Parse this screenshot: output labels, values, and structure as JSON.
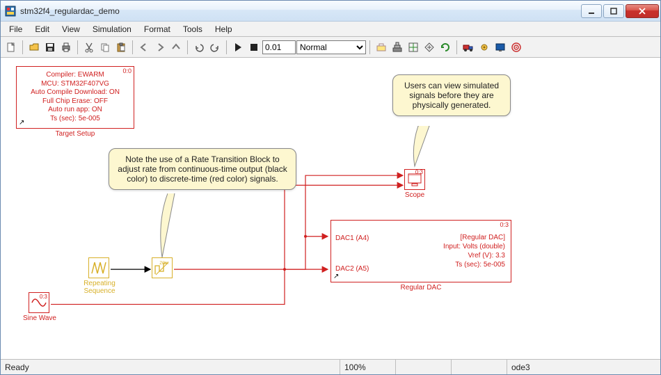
{
  "window": {
    "title": "stm32f4_regulardac_demo"
  },
  "menu": {
    "items": [
      "File",
      "Edit",
      "View",
      "Simulation",
      "Format",
      "Tools",
      "Help"
    ]
  },
  "toolbar": {
    "step_value": "0.01",
    "mode_options": [
      "Normal"
    ],
    "mode_selected": "Normal"
  },
  "target_setup": {
    "corner": "0:0",
    "lines": [
      "Compiler: EWARM",
      "MCU: STM32F407VG",
      "Auto Compile Download: ON",
      "Full Chip Erase: OFF",
      "Auto run app: ON",
      "Ts (sec): 5e-005"
    ],
    "label": "Target Setup"
  },
  "callout_rate": {
    "text": "Note the use of a Rate Transition Block to adjust rate from continuous-time output (black color) to discrete-time (red color) signals."
  },
  "callout_scope": {
    "text": "Users can view simulated signals before they are physically generated."
  },
  "repeating_sequence": {
    "label": "Repeating\nSequence"
  },
  "sine_wave": {
    "label": "Sine Wave"
  },
  "rate_transition": {
    "label": "ZOH"
  },
  "scope": {
    "label": "Scope",
    "corner": "0:3"
  },
  "dac": {
    "corner": "0:3",
    "port1": "DAC1 (A4)",
    "port2": "DAC2 (A5)",
    "info": [
      "[Regular DAC]",
      "Input: Volts (double)",
      "Vref (V): 3.3",
      "Ts (sec): 5e-005"
    ],
    "label": "Regular DAC"
  },
  "status": {
    "ready": "Ready",
    "zoom": "100%",
    "solver": "ode3"
  }
}
